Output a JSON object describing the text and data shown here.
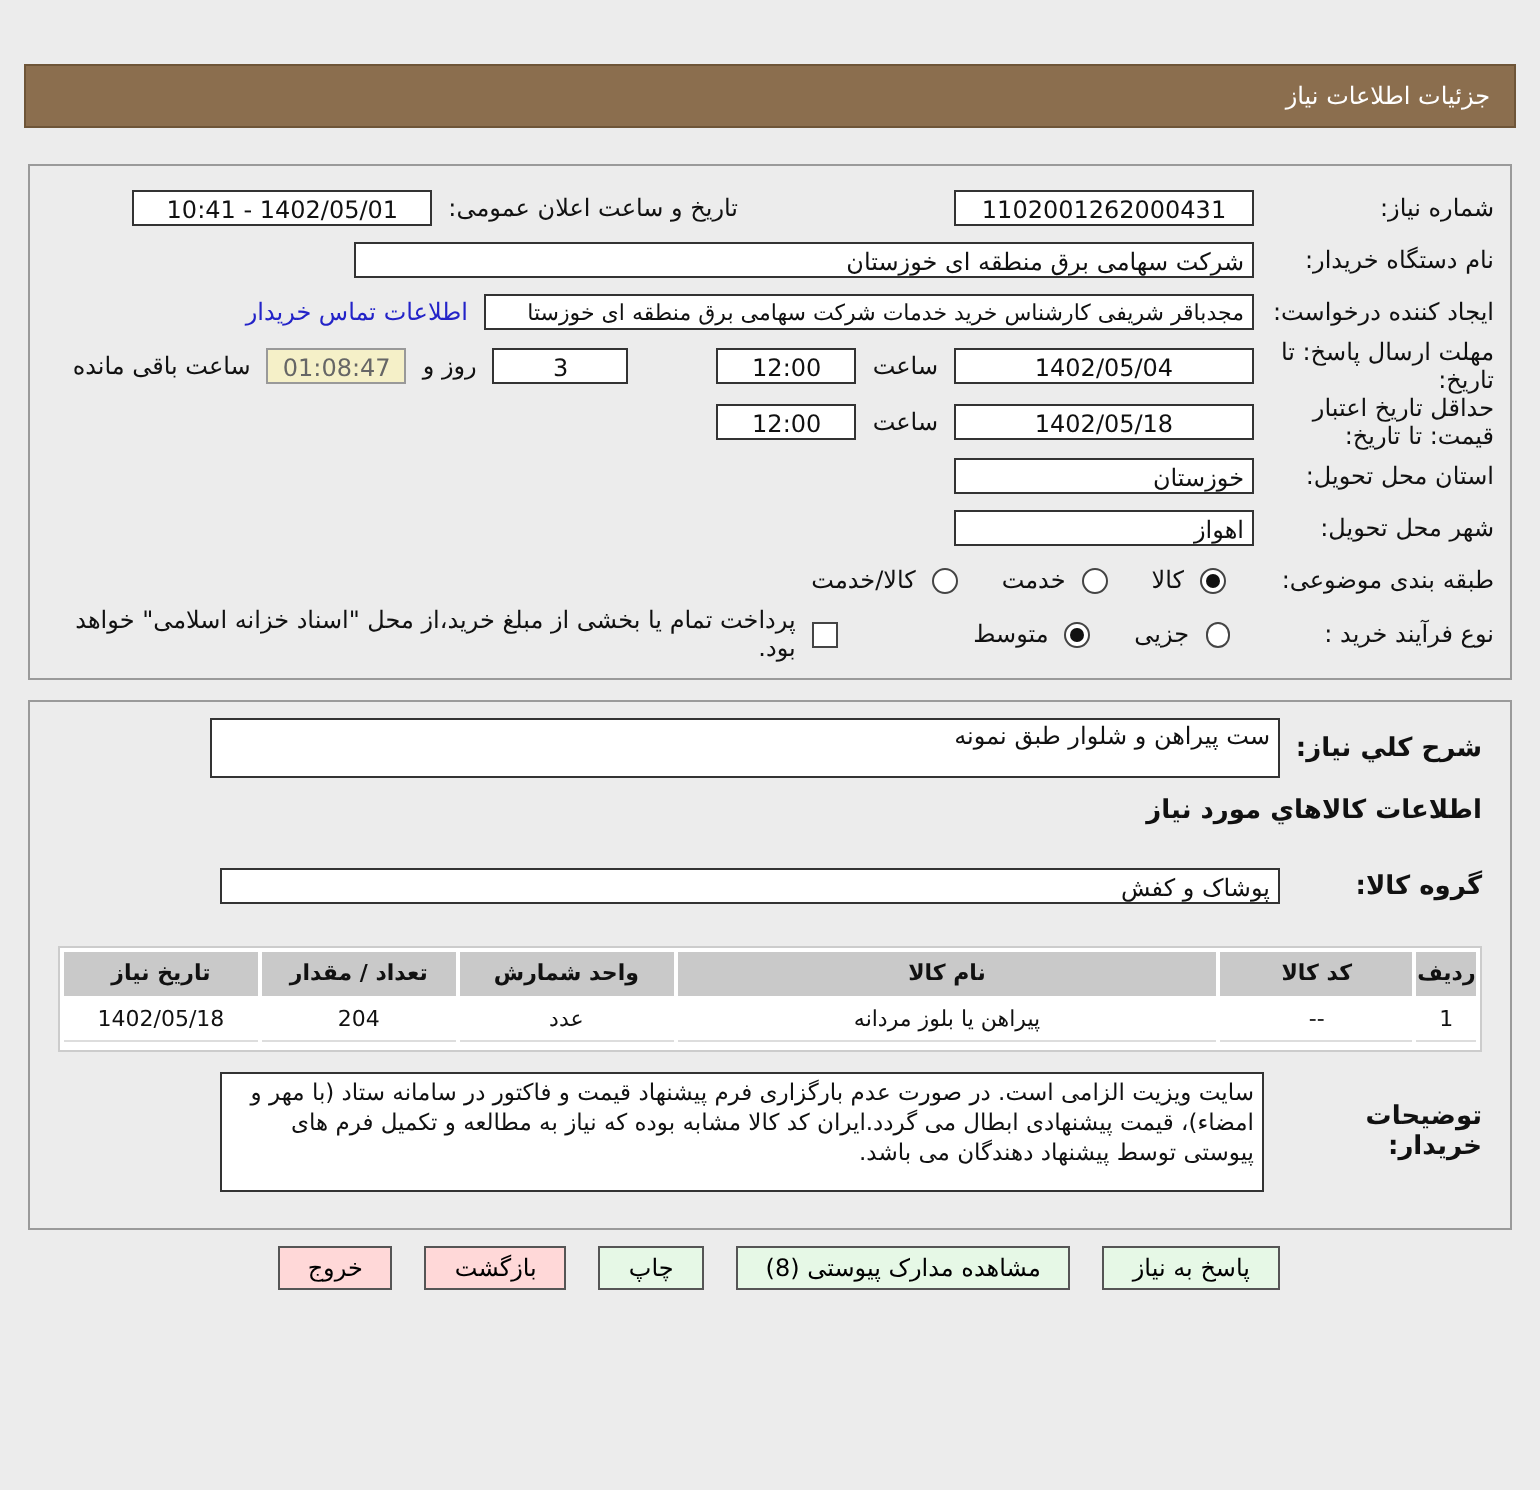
{
  "header": {
    "title": "جزئیات اطلاعات نیاز"
  },
  "need_number": {
    "label": "شماره نیاز:",
    "value": "1102001262000431"
  },
  "announce": {
    "label": "تاریخ و ساعت اعلان عمومی:",
    "value": "1402/05/01 - 10:41"
  },
  "buyer": {
    "label": "نام دستگاه خریدار:",
    "value": "شرکت سهامی برق منطقه ای خوزستان"
  },
  "requester": {
    "label": "ایجاد کننده درخواست:",
    "value": "مجدباقر شریفی کارشناس خرید خدمات شرکت سهامی برق منطقه ای خوزستا",
    "link": "اطلاعات تماس خریدار"
  },
  "deadline": {
    "label": "مهلت ارسال پاسخ: تا تاریخ:",
    "date": "1402/05/04",
    "time_label": "ساعت",
    "time": "12:00",
    "days": "3",
    "days_label": "روز و",
    "remaining": "01:08:47",
    "remaining_label": "ساعت باقی مانده"
  },
  "validity": {
    "label": "حداقل تاریخ اعتبار قیمت: تا تاریخ:",
    "date": "1402/05/18",
    "time_label": "ساعت",
    "time": "12:00"
  },
  "province": {
    "label": "استان محل تحویل:",
    "value": "خوزستان"
  },
  "city": {
    "label": "شهر محل تحویل:",
    "value": "اهواز"
  },
  "category": {
    "label": "طبقه بندی موضوعی:",
    "options": [
      {
        "label": "کالا",
        "selected": true
      },
      {
        "label": "خدمت",
        "selected": false
      },
      {
        "label": "کالا/خدمت",
        "selected": false
      }
    ]
  },
  "process": {
    "label": "نوع فرآیند خرید :",
    "options": [
      {
        "label": "جزیی",
        "selected": false
      },
      {
        "label": "متوسط",
        "selected": true
      }
    ],
    "payment": {
      "checked": false,
      "text": "پرداخت تمام یا بخشی از مبلغ خرید،از محل \"اسناد خزانه اسلامی\" خواهد بود."
    }
  },
  "description": {
    "label": "شرح کلي نیاز:",
    "value": "ست پیراهن و شلوار طبق نمونه"
  },
  "goods_title": "اطلاعات کالاهاي مورد نیاز",
  "group": {
    "label": "گروه کالا:",
    "value": "پوشاک و کفش"
  },
  "table": {
    "columns": [
      "ردیف",
      "کد کالا",
      "نام کالا",
      "واحد شمارش",
      "تعداد / مقدار",
      "تاریخ نیاز"
    ],
    "rows": [
      [
        "1",
        "--",
        "پیراهن یا بلوز مردانه",
        "عدد",
        "204",
        "1402/05/18"
      ]
    ]
  },
  "notes": {
    "label": "توضیحات خریدار:",
    "value": "سایت ویزیت الزامی است. در صورت عدم بارگزاری فرم پیشنهاد قیمت و فاکتور در سامانه ستاد (با مهر و امضاء)، قیمت پیشنهادی ابطال می گردد.ایران کد کالا مشابه بوده که نیاز به مطالعه و تکمیل فرم های پیوستی توسط پیشنهاد دهندگان می باشد."
  },
  "buttons": [
    {
      "label": "پاسخ به نیاز",
      "kind": "action"
    },
    {
      "label": "مشاهده مدارک پیوستی (8)",
      "kind": "action"
    },
    {
      "label": "چاپ",
      "kind": "action"
    },
    {
      "label": "بازگشت",
      "kind": "back"
    },
    {
      "label": "خروج",
      "kind": "back"
    }
  ]
}
